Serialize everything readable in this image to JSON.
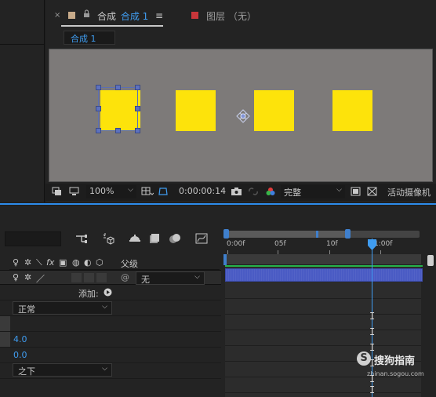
{
  "comp_panel": {
    "tab_close": "×",
    "tab_prefix": "合成",
    "tab_active": "合成 1",
    "tab_menu": "≡",
    "layer_tab": "图层 （无）",
    "comp_chip": "合成 1",
    "swatch_color": "#c8ab8a",
    "layer_swatch_color": "#c9363a"
  },
  "viewer": {
    "background": "#7d7a79",
    "square_color": "#fde30b",
    "squares": [
      "square-1",
      "square-2",
      "square-3",
      "square-4"
    ]
  },
  "viewer_bar": {
    "zoom": "100%",
    "timecode": "0:00:00:14",
    "resolution": "完整",
    "camera": "活动摄像机"
  },
  "timeline": {
    "col_parent": "父级",
    "col_switches": "fx",
    "layer_parent_value": "无",
    "add_label": "添加:",
    "blend_mode": "正常",
    "value_1": "4.0",
    "value_2": "0.0",
    "stack_mode": "之下",
    "ruler_labels": [
      "0:00f",
      "05f",
      "10f",
      "1:00f"
    ],
    "accent": "#3f9cf0",
    "layer_bar_color": "#4a5bc4"
  },
  "watermark": {
    "logo": "S",
    "text": "搜狗指南",
    "sub": "zhinan.sogou.com"
  }
}
